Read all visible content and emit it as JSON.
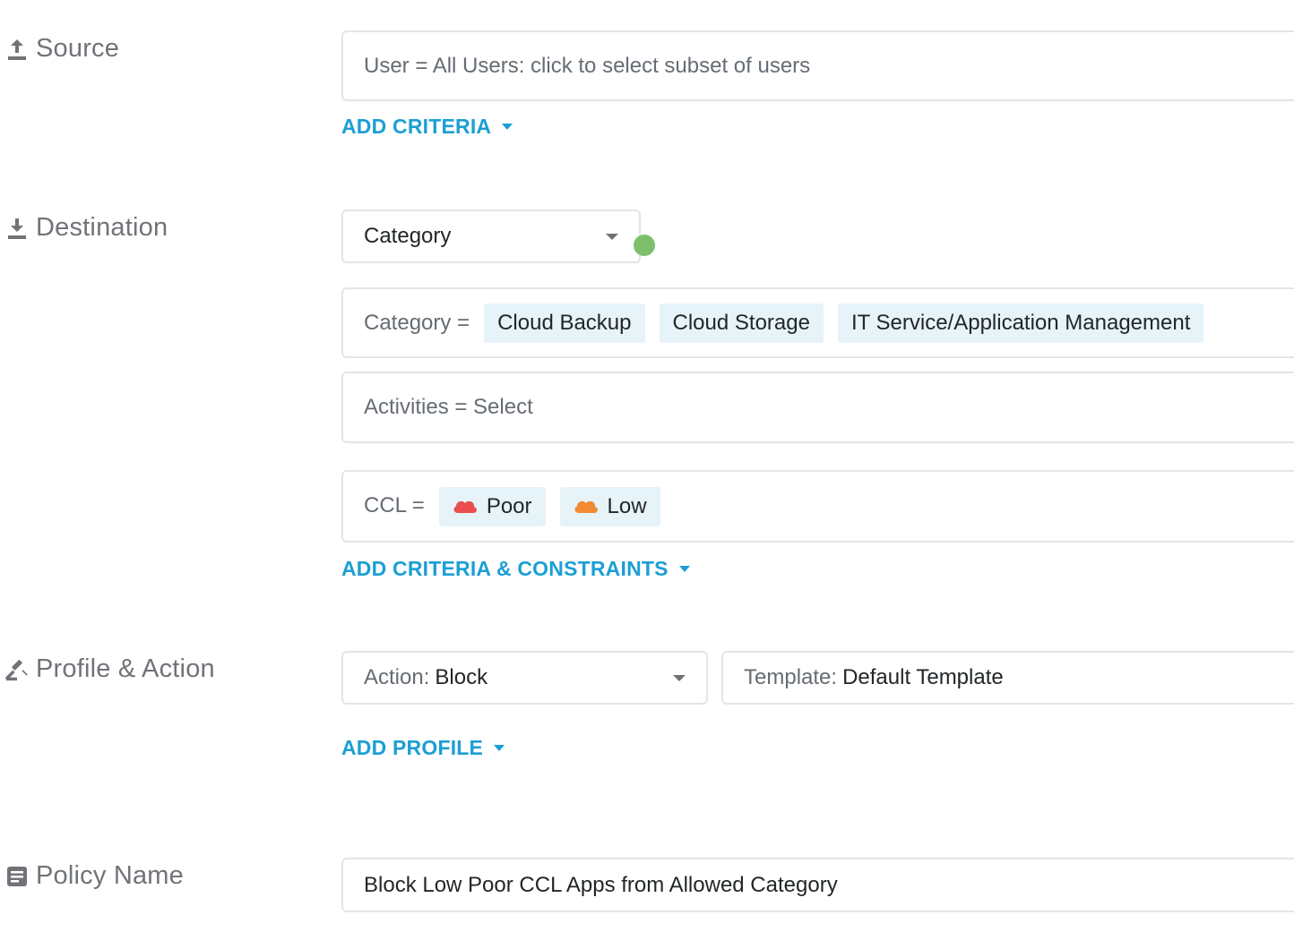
{
  "source": {
    "label": "Source",
    "icon": "upload-icon",
    "user_field": "User = All Users: click to select subset of users",
    "add_criteria": "ADD CRITERIA"
  },
  "destination": {
    "label": "Destination",
    "icon": "download-icon",
    "type_select": "Category",
    "category": {
      "prefix": "Category =",
      "chips": [
        "Cloud Backup",
        "Cloud Storage",
        "IT Service/Application Management"
      ]
    },
    "activities": "Activities = Select",
    "ccl": {
      "prefix": "CCL =",
      "chips": [
        {
          "label": "Poor",
          "color": "#ea4e4e"
        },
        {
          "label": "Low",
          "color": "#f28a33"
        }
      ]
    },
    "add_criteria": "ADD CRITERIA & CONSTRAINTS",
    "status_color": "#7cc06d"
  },
  "profile_action": {
    "label": "Profile & Action",
    "icon": "gavel-icon",
    "action_label": "Action:",
    "action_value": "Block",
    "template_label": "Template:",
    "template_value": "Default Template",
    "add_profile": "ADD PROFILE"
  },
  "policy_name": {
    "label": "Policy Name",
    "icon": "document-icon",
    "value": "Block Low Poor CCL Apps from Allowed Category"
  },
  "colors": {
    "accent": "#1b9fd4",
    "label": "#707378",
    "chip_bg": "#e6f3f8",
    "border": "#e3e5e8"
  }
}
